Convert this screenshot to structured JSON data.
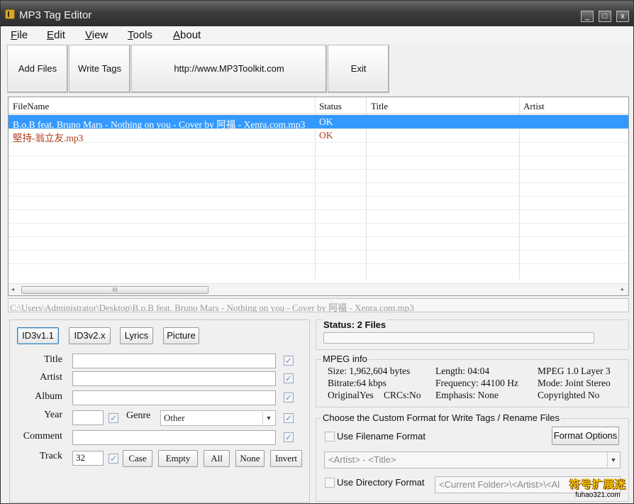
{
  "window": {
    "title": "MP3 Tag Editor",
    "controls": [
      "_",
      "□",
      "x"
    ]
  },
  "menu": [
    {
      "label": "File",
      "key": "F",
      "rest": "ile"
    },
    {
      "label": "Edit",
      "key": "E",
      "rest": "dit"
    },
    {
      "label": "View",
      "key": "V",
      "rest": "iew"
    },
    {
      "label": "Tools",
      "key": "T",
      "rest": "ools"
    },
    {
      "label": "About",
      "key": "A",
      "rest": "bout"
    }
  ],
  "toolbar": {
    "add_files": "Add Files",
    "write_tags": "Write Tags",
    "website": "http://www.MP3Toolkit.com",
    "exit": "Exit"
  },
  "filelist": {
    "columns": [
      "FileName",
      "Status",
      "Title",
      "Artist"
    ],
    "rows": [
      {
        "filename": "B.o.B feat. Bruno Mars - Nothing on you - Cover by 阿福 - Xenra.com.mp3",
        "status": "OK",
        "title": "",
        "artist": "",
        "selected": true
      },
      {
        "filename": "堅持-翁立友.mp3",
        "status": "OK",
        "title": "",
        "artist": "",
        "selected": false
      }
    ],
    "scroll_thumb": "III"
  },
  "path": "C:\\Users\\Administrator\\Desktop\\B.o.B feat. Bruno Mars - Nothing on you - Cover by 阿福 - Xenra.com.mp3",
  "tag_tabs": [
    "ID3v1.1",
    "ID3v2.x",
    "Lyrics",
    "Picture"
  ],
  "tag_fields": {
    "title_label": "Title",
    "artist_label": "Artist",
    "album_label": "Album",
    "year_label": "Year",
    "genre_label": "Genre",
    "genre_value": "Other",
    "comment_label": "Comment",
    "track_label": "Track",
    "track_value": "32",
    "check_mark": "✓"
  },
  "tag_buttons": [
    "Case",
    "Empty",
    "All",
    "None",
    "Invert"
  ],
  "status": {
    "text": "Status: 2 Files"
  },
  "mpeg_info": {
    "title": "MPEG info",
    "size": "Size: 1,962,604 bytes",
    "bitrate": "Bitrate:64 kbps",
    "original": "OriginalYes",
    "crcs": "CRCs:No",
    "length": "Length: 04:04",
    "frequency": "Frequency: 44100 Hz",
    "emphasis": "Emphasis: None",
    "layer": "MPEG 1.0 Layer 3",
    "mode": "Mode: Joint Stereo",
    "copyrighted": "Copyrighted No"
  },
  "custom_format": {
    "title": "Choose the Custom Format for Write Tags / Rename Files",
    "use_filename": "Use Filename Format",
    "format_options": "Format Options",
    "filename_format": "<Artist> - <Title>",
    "use_directory": "Use Directory Format",
    "directory_format": "<Current Folder>\\<Artist>\\<Al"
  },
  "watermark": {
    "main": "符号扩展迷",
    "sub": "fuhao321.com"
  },
  "colors": {
    "selected_row": "#3399ff",
    "second_row_text": "#b03a1a",
    "title_bar": "#3c3c3c"
  }
}
